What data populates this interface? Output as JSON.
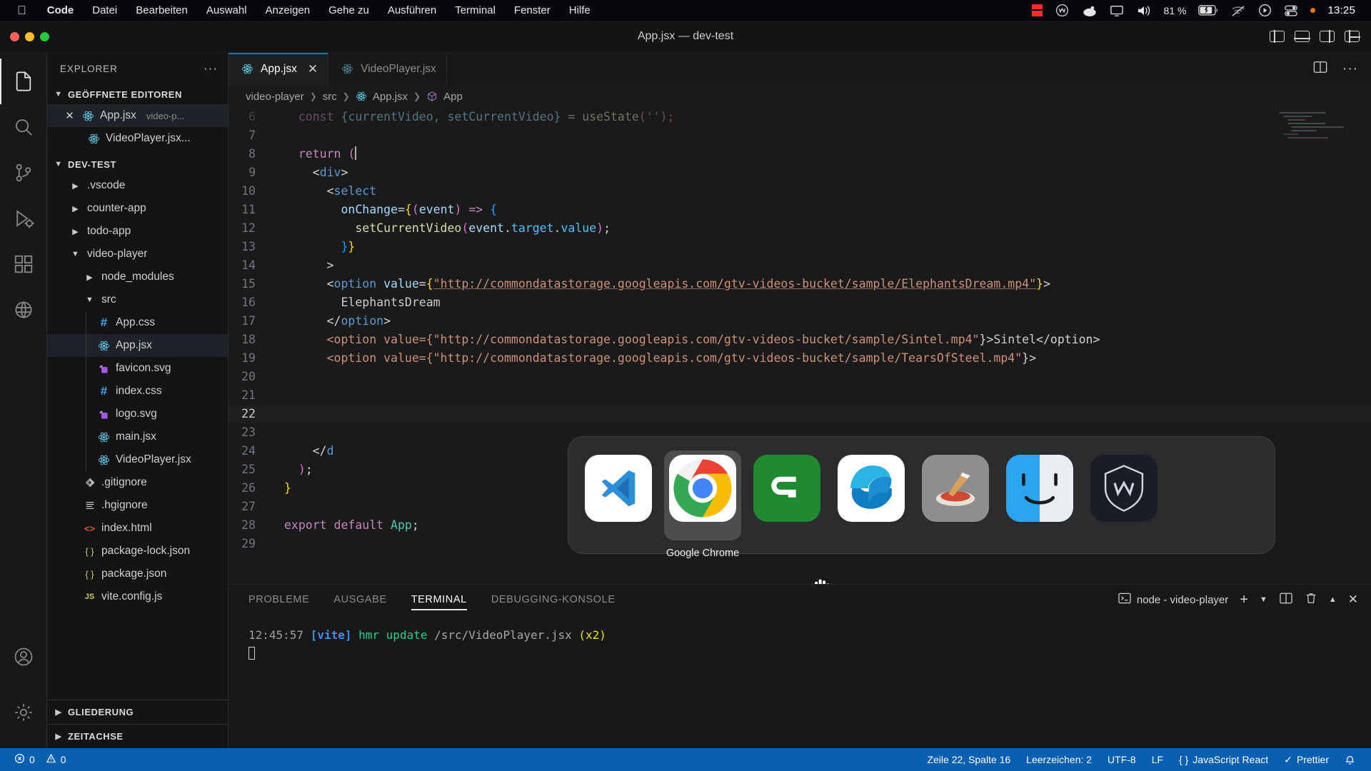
{
  "menubar": {
    "apple_icon": "apple-icon",
    "items": [
      {
        "label": "Code",
        "bold": true
      },
      {
        "label": "Datei",
        "bold": false
      },
      {
        "label": "Bearbeiten",
        "bold": false
      },
      {
        "label": "Auswahl",
        "bold": false
      },
      {
        "label": "Anzeigen",
        "bold": false
      },
      {
        "label": "Gehe zu",
        "bold": false
      },
      {
        "label": "Ausführen",
        "bold": false
      },
      {
        "label": "Terminal",
        "bold": false
      },
      {
        "label": "Fenster",
        "bold": false
      },
      {
        "label": "Hilfe",
        "bold": false
      }
    ],
    "tray": {
      "battery_percent": "81 %",
      "clock": "13:25",
      "icons": [
        "stop-recording-icon",
        "wacom-icon",
        "blob-icon",
        "display-icon",
        "volume-icon",
        "battery-icon",
        "wifi-off-icon",
        "now-playing-icon",
        "control-center-icon",
        "orange-dot-icon"
      ]
    }
  },
  "window": {
    "title": "App.jsx — dev-test",
    "traffic_lights": [
      "close",
      "minimize",
      "maximize"
    ],
    "layout_icons": [
      "toggle-primary-sidebar-icon",
      "toggle-panel-icon",
      "toggle-secondary-sidebar-icon",
      "customize-layout-icon"
    ]
  },
  "activity_bar": {
    "items": [
      {
        "name": "explorer",
        "icon": "files-icon",
        "active": true
      },
      {
        "name": "search",
        "icon": "search-icon",
        "active": false
      },
      {
        "name": "source-control",
        "icon": "source-control-icon",
        "active": false
      },
      {
        "name": "run-and-debug",
        "icon": "run-debug-icon",
        "active": false
      },
      {
        "name": "extensions",
        "icon": "extensions-icon",
        "active": false
      },
      {
        "name": "remote-explorer",
        "icon": "remote-icon",
        "active": false
      }
    ],
    "bottom": [
      {
        "name": "accounts",
        "icon": "account-icon"
      },
      {
        "name": "manage",
        "icon": "gear-icon"
      }
    ]
  },
  "sidebar": {
    "title": "EXPLORER",
    "more_actions": "···",
    "open_editors": {
      "label": "GEÖFFNETE EDITOREN",
      "items": [
        {
          "name": "App.jsx",
          "suffix": "video-p...",
          "icon": "react-icon",
          "selected": true,
          "close": "✕"
        },
        {
          "name": "VideoPlayer.jsx...",
          "suffix": "",
          "icon": "react-icon",
          "selected": false,
          "close": ""
        }
      ]
    },
    "workspace": {
      "label": "DEV-TEST",
      "items": [
        {
          "name": ".vscode",
          "type": "folder",
          "expanded": false,
          "depth": 1,
          "icon": "chevron-right-icon"
        },
        {
          "name": "counter-app",
          "type": "folder",
          "expanded": false,
          "depth": 1,
          "icon": "chevron-right-icon"
        },
        {
          "name": "todo-app",
          "type": "folder",
          "expanded": false,
          "depth": 1,
          "icon": "chevron-right-icon"
        },
        {
          "name": "video-player",
          "type": "folder",
          "expanded": true,
          "depth": 1,
          "icon": "chevron-down-icon"
        },
        {
          "name": "node_modules",
          "type": "folder",
          "expanded": false,
          "depth": 2,
          "icon": "chevron-right-icon"
        },
        {
          "name": "src",
          "type": "folder",
          "expanded": true,
          "depth": 2,
          "icon": "chevron-down-icon"
        },
        {
          "name": "App.css",
          "type": "file",
          "depth": 3,
          "icon": "css-icon"
        },
        {
          "name": "App.jsx",
          "type": "file",
          "depth": 3,
          "icon": "react-icon",
          "selected": true
        },
        {
          "name": "favicon.svg",
          "type": "file",
          "depth": 3,
          "icon": "svg-icon"
        },
        {
          "name": "index.css",
          "type": "file",
          "depth": 3,
          "icon": "css-icon"
        },
        {
          "name": "logo.svg",
          "type": "file",
          "depth": 3,
          "icon": "svg-icon"
        },
        {
          "name": "main.jsx",
          "type": "file",
          "depth": 3,
          "icon": "react-icon"
        },
        {
          "name": "VideoPlayer.jsx",
          "type": "file",
          "depth": 3,
          "icon": "react-icon"
        },
        {
          "name": ".gitignore",
          "type": "file",
          "depth": 2,
          "icon": "git-icon"
        },
        {
          "name": ".hgignore",
          "type": "file",
          "depth": 2,
          "icon": "lines-icon"
        },
        {
          "name": "index.html",
          "type": "file",
          "depth": 2,
          "icon": "html-icon"
        },
        {
          "name": "package-lock.json",
          "type": "file",
          "depth": 2,
          "icon": "json-icon"
        },
        {
          "name": "package.json",
          "type": "file",
          "depth": 2,
          "icon": "json-icon"
        },
        {
          "name": "vite.config.js",
          "type": "file",
          "depth": 2,
          "icon": "js-icon"
        }
      ]
    },
    "bottom_sections": [
      {
        "label": "GLIEDERUNG",
        "icon": "chevron-right-icon"
      },
      {
        "label": "ZEITACHSE",
        "icon": "chevron-right-icon"
      }
    ]
  },
  "editor": {
    "tabs": [
      {
        "label": "App.jsx",
        "icon": "react-icon",
        "active": true,
        "close": "✕"
      },
      {
        "label": "VideoPlayer.jsx",
        "icon": "react-icon",
        "active": false,
        "close": ""
      }
    ],
    "tab_actions": [
      "split-editor-icon",
      "more-actions-icon"
    ],
    "breadcrumb": [
      "video-player",
      "src",
      "App.jsx",
      "App"
    ],
    "breadcrumb_icons": {
      "file": "react-icon",
      "symbol": "symbol-class-icon"
    },
    "lines": [
      {
        "n": "6",
        "tokens": [
          {
            "t": "  const ",
            "c": "t-kw"
          },
          {
            "t": "{currentVideo, setCurrentVideo}",
            "c": "t-var"
          },
          {
            "t": " = ",
            "c": "t-punc"
          },
          {
            "t": "useState",
            "c": "t-fn"
          },
          {
            "t": "('');",
            "c": "t-str"
          }
        ],
        "faded": true
      },
      {
        "n": "7",
        "tokens": []
      },
      {
        "n": "8",
        "tokens": [
          {
            "t": "  ",
            "c": "t-punc"
          },
          {
            "t": "return",
            "c": "t-kw"
          },
          {
            "t": " ",
            "c": "t-punc"
          },
          {
            "t": "(",
            "c": "t-brace2"
          }
        ]
      },
      {
        "n": "9",
        "tokens": [
          {
            "t": "    ",
            "c": "t-punc"
          },
          {
            "t": "<",
            "c": "t-punc"
          },
          {
            "t": "div",
            "c": "t-tag"
          },
          {
            "t": ">",
            "c": "t-punc"
          }
        ]
      },
      {
        "n": "10",
        "tokens": [
          {
            "t": "      ",
            "c": "t-punc"
          },
          {
            "t": "<",
            "c": "t-punc"
          },
          {
            "t": "select",
            "c": "t-tag"
          }
        ]
      },
      {
        "n": "11",
        "tokens": [
          {
            "t": "        ",
            "c": "t-punc"
          },
          {
            "t": "onChange",
            "c": "t-attr"
          },
          {
            "t": "=",
            "c": "t-punc"
          },
          {
            "t": "{",
            "c": "t-brace1"
          },
          {
            "t": "(",
            "c": "t-brace2"
          },
          {
            "t": "event",
            "c": "t-var"
          },
          {
            "t": ")",
            "c": "t-brace2"
          },
          {
            "t": " ",
            "c": "t-punc"
          },
          {
            "t": "=>",
            "c": "t-kw"
          },
          {
            "t": " ",
            "c": "t-punc"
          },
          {
            "t": "{",
            "c": "t-brace3"
          }
        ]
      },
      {
        "n": "12",
        "tokens": [
          {
            "t": "          ",
            "c": "t-punc"
          },
          {
            "t": "setCurrentVideo",
            "c": "t-fn"
          },
          {
            "t": "(",
            "c": "t-brace2"
          },
          {
            "t": "event",
            "c": "t-var"
          },
          {
            "t": ".",
            "c": "t-punc"
          },
          {
            "t": "target",
            "c": "t-blue"
          },
          {
            "t": ".",
            "c": "t-punc"
          },
          {
            "t": "value",
            "c": "t-blue"
          },
          {
            "t": ")",
            "c": "t-brace2"
          },
          {
            "t": ";",
            "c": "t-punc"
          }
        ]
      },
      {
        "n": "13",
        "tokens": [
          {
            "t": "        ",
            "c": "t-punc"
          },
          {
            "t": "}",
            "c": "t-brace3"
          },
          {
            "t": "}",
            "c": "t-brace1"
          }
        ]
      },
      {
        "n": "14",
        "tokens": [
          {
            "t": "      ",
            "c": "t-punc"
          },
          {
            "t": ">",
            "c": "t-punc"
          }
        ]
      },
      {
        "n": "15",
        "tokens": [
          {
            "t": "      ",
            "c": "t-punc"
          },
          {
            "t": "<",
            "c": "t-punc"
          },
          {
            "t": "option",
            "c": "t-tag"
          },
          {
            "t": " ",
            "c": "t-punc"
          },
          {
            "t": "value",
            "c": "t-attr"
          },
          {
            "t": "=",
            "c": "t-punc"
          },
          {
            "t": "{",
            "c": "t-brace1"
          },
          {
            "t": "\"http://commondatastorage.googleapis.com/gtv-videos-bucket/sample/ElephantsDream.mp4\"",
            "c": "t-str t-urlu"
          },
          {
            "t": "}",
            "c": "t-brace1"
          },
          {
            "t": ">",
            "c": "t-punc"
          }
        ]
      },
      {
        "n": "16",
        "tokens": [
          {
            "t": "        ",
            "c": "t-punc"
          },
          {
            "t": "ElephantsDream",
            "c": "t-txt"
          }
        ]
      },
      {
        "n": "17",
        "tokens": [
          {
            "t": "      ",
            "c": "t-punc"
          },
          {
            "t": "</",
            "c": "t-punc"
          },
          {
            "t": "option",
            "c": "t-tag"
          },
          {
            "t": ">",
            "c": "t-punc"
          }
        ]
      },
      {
        "n": "18",
        "tokens": [
          {
            "t": "      ",
            "c": "t-punc"
          },
          {
            "t": "<option value={\"http://commondatastorage.googleapis.com/gtv-videos-bucket/sample/Sintel.mp4\"",
            "c": "t-str"
          },
          {
            "t": "}>",
            "c": "t-punc"
          },
          {
            "t": "Sintel",
            "c": "t-txt"
          },
          {
            "t": "</option>",
            "c": "t-punc"
          }
        ]
      },
      {
        "n": "19",
        "tokens": [
          {
            "t": "      ",
            "c": "t-punc"
          },
          {
            "t": "<option value={\"http://commondatastorage.googleapis.com/gtv-videos-bucket/sample/TearsOfSteel.mp4\"",
            "c": "t-str"
          },
          {
            "t": "}>",
            "c": "t-punc"
          }
        ]
      },
      {
        "n": "20",
        "tokens": []
      },
      {
        "n": "21",
        "tokens": []
      },
      {
        "n": "22",
        "tokens": [],
        "current": true
      },
      {
        "n": "23",
        "tokens": []
      },
      {
        "n": "24",
        "tokens": [
          {
            "t": "    ",
            "c": "t-punc"
          },
          {
            "t": "</",
            "c": "t-punc"
          },
          {
            "t": "d",
            "c": "t-tag"
          }
        ]
      },
      {
        "n": "25",
        "tokens": [
          {
            "t": "  ",
            "c": "t-punc"
          },
          {
            "t": ")",
            "c": "t-brace2"
          },
          {
            "t": ";",
            "c": "t-punc"
          }
        ]
      },
      {
        "n": "26",
        "tokens": [
          {
            "t": "}",
            "c": "t-brace1"
          }
        ]
      },
      {
        "n": "27",
        "tokens": []
      },
      {
        "n": "28",
        "tokens": [
          {
            "t": "export",
            "c": "t-kw"
          },
          {
            "t": " ",
            "c": "t-punc"
          },
          {
            "t": "default",
            "c": "t-kw"
          },
          {
            "t": " ",
            "c": "t-punc"
          },
          {
            "t": "App",
            "c": "t-id"
          },
          {
            "t": ";",
            "c": "t-punc"
          }
        ]
      },
      {
        "n": "29",
        "tokens": []
      }
    ]
  },
  "app_switcher": {
    "selected_label": "Google Chrome",
    "apps": [
      {
        "name": "Visual Studio Code",
        "icon": "vscode-icon",
        "selected": false
      },
      {
        "name": "Google Chrome",
        "icon": "chrome-icon",
        "selected": true
      },
      {
        "name": "Camtasia",
        "icon": "camtasia-icon",
        "selected": false
      },
      {
        "name": "Microsoft Edge",
        "icon": "edge-icon",
        "selected": false
      },
      {
        "name": "Preview",
        "icon": "preview-icon",
        "selected": false
      },
      {
        "name": "Finder",
        "icon": "finder-icon",
        "selected": false
      },
      {
        "name": "Wacom Center",
        "icon": "wacom-icon",
        "selected": false
      }
    ]
  },
  "panel": {
    "tabs": [
      {
        "label": "PROBLEME",
        "active": false
      },
      {
        "label": "AUSGABE",
        "active": false
      },
      {
        "label": "TERMINAL",
        "active": true
      },
      {
        "label": "DEBUGGING-KONSOLE",
        "active": false
      }
    ],
    "terminal_selector": "node - video-player",
    "actions": [
      "new-terminal-icon",
      "chevron-down-icon",
      "split-terminal-icon",
      "trash-icon",
      "chevron-up-icon",
      "close-icon"
    ],
    "output": {
      "timestamp": "12:45:57",
      "tag": "[vite]",
      "message": "hmr update",
      "path": "/src/VideoPlayer.jsx",
      "count": "(x2)"
    }
  },
  "statusbar": {
    "errors": "0",
    "warnings": "0",
    "position": "Zeile 22, Spalte 16",
    "indent": "Leerzeichen: 2",
    "encoding": "UTF-8",
    "eol": "LF",
    "language": "JavaScript React",
    "formatter": "Prettier",
    "bell": "bell-icon",
    "accent": "#0b5fb3"
  }
}
